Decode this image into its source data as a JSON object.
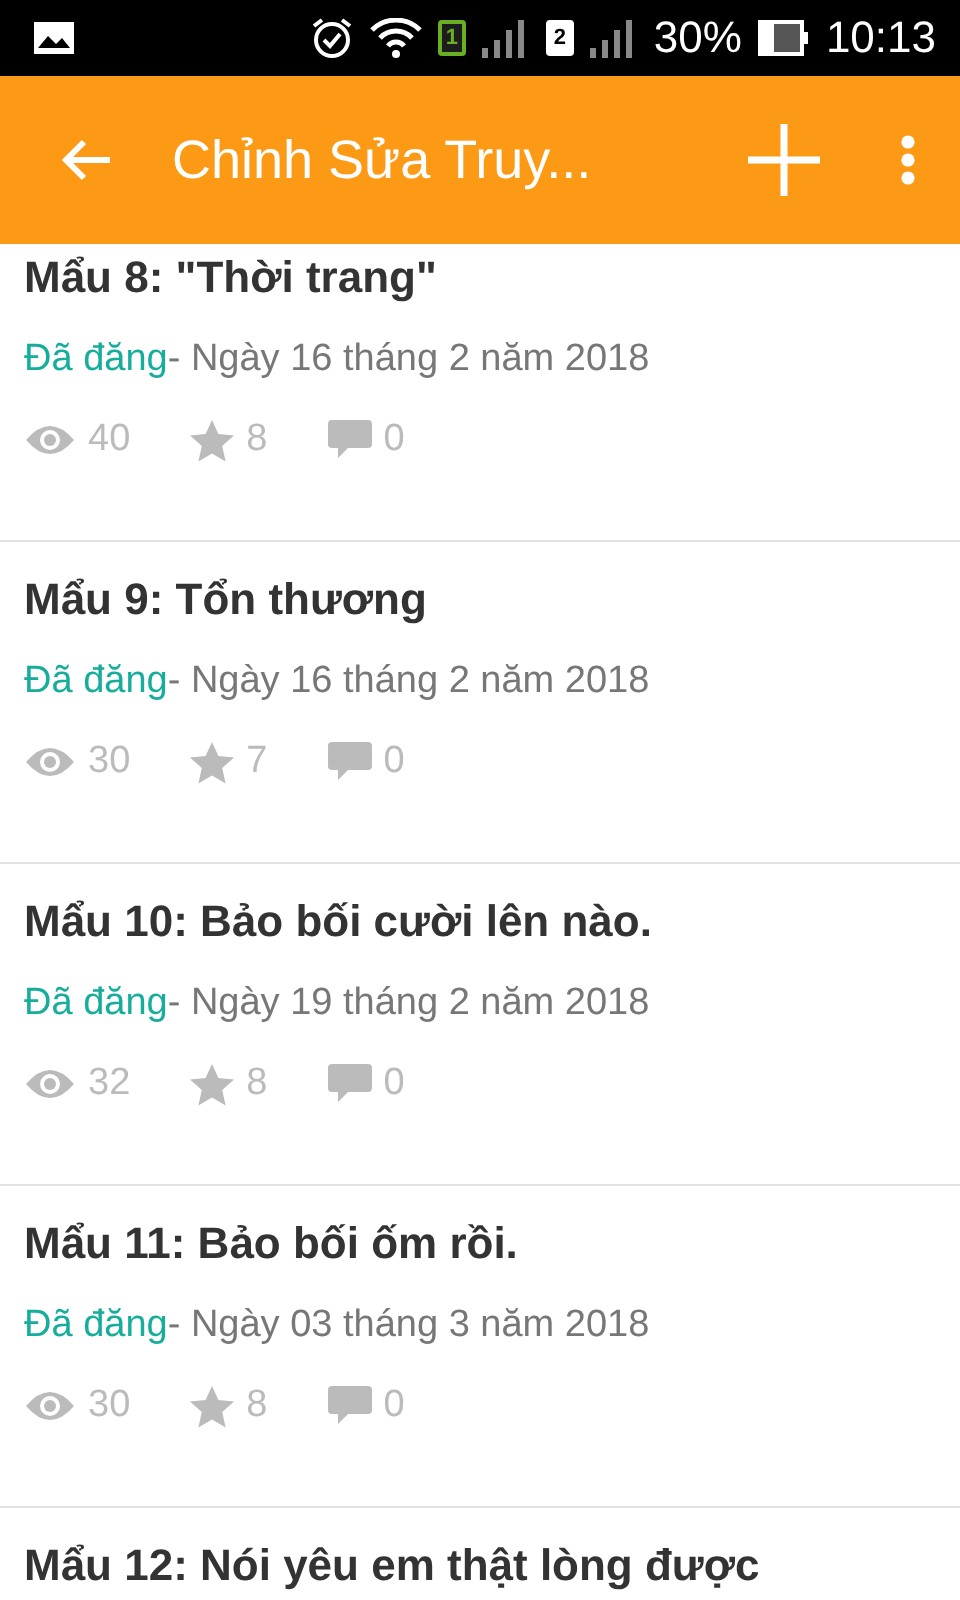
{
  "status_bar": {
    "sims": [
      {
        "label": "1",
        "active": true
      },
      {
        "label": "2",
        "active": false
      }
    ],
    "battery": "30%",
    "time": "10:13"
  },
  "toolbar": {
    "title": "Chỉnh Sửa Truy..."
  },
  "parts": [
    {
      "title": "Mẩu 8: \"Thời trang\"",
      "state": "Đã đăng",
      "date": "- Ngày 16 tháng 2 năm 2018",
      "views": "40",
      "votes": "8",
      "comments": "0"
    },
    {
      "title": "Mẩu 9: Tổn thương",
      "state": "Đã đăng",
      "date": "- Ngày 16 tháng 2 năm 2018",
      "views": "30",
      "votes": "7",
      "comments": "0"
    },
    {
      "title": "Mẩu 10: Bảo bối cười lên nào.",
      "state": "Đã đăng",
      "date": "- Ngày 19 tháng 2 năm 2018",
      "views": "32",
      "votes": "8",
      "comments": "0"
    },
    {
      "title": "Mẩu 11: Bảo bối ốm rồi.",
      "state": "Đã đăng",
      "date": "- Ngày 03 tháng 3 năm 2018",
      "views": "30",
      "votes": "8",
      "comments": "0"
    },
    {
      "title": "Mẩu 12: Nói yêu em thật lòng được"
    }
  ]
}
